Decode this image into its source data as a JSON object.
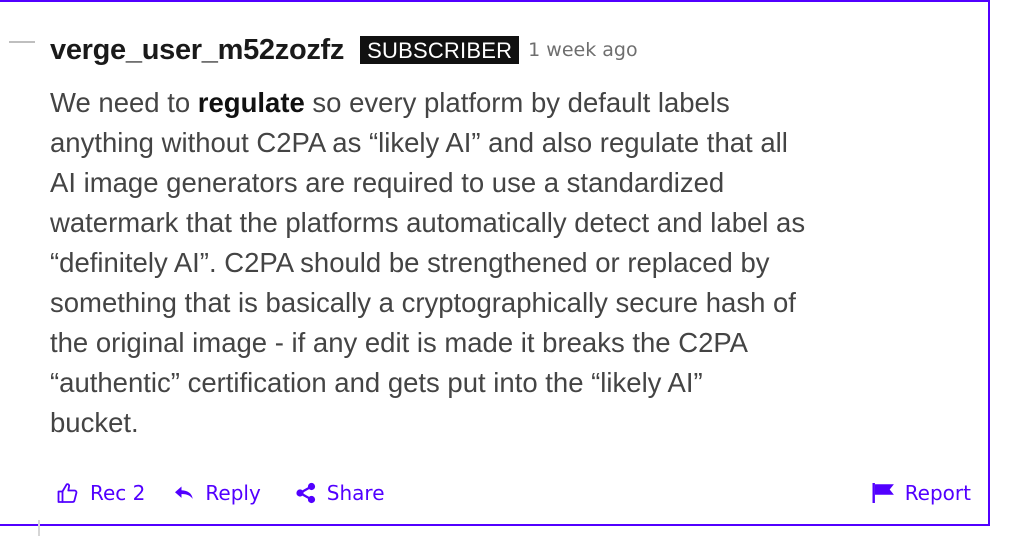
{
  "comment": {
    "username": "verge_user_m52zozfz",
    "badge": "SUBSCRIBER",
    "timestamp": "1 week ago",
    "lines": [
      [
        {
          "text": "We need to "
        },
        {
          "text": "regulate",
          "bold": true
        },
        {
          "text": " so every platform by default labels"
        }
      ],
      [
        {
          "text": "anything without C2PA as “likely AI” and also regulate that all"
        }
      ],
      [
        {
          "text": "AI image generators are required to use a standardized"
        }
      ],
      [
        {
          "text": "watermark that the platforms automatically detect and label as"
        }
      ],
      [
        {
          "text": "“definitely AI”. C2PA should be strengthened or replaced by"
        }
      ],
      [
        {
          "text": "something that is basically a cryptographically secure hash of"
        }
      ],
      [
        {
          "text": "the original image - if any edit is made it breaks the C2PA"
        }
      ],
      [
        {
          "text": "“authentic” certification and gets put into the “likely AI”"
        }
      ],
      [
        {
          "text": "bucket."
        }
      ]
    ]
  },
  "actions": {
    "rec_label": "Rec 2",
    "reply_label": "Reply",
    "share_label": "Share",
    "report_label": "Report"
  },
  "icons": {
    "rec": "thumbs-up-icon",
    "reply": "reply-arrow-icon",
    "share": "share-icon",
    "report": "flag-icon",
    "collapse": "collapse-dash-icon"
  },
  "colors": {
    "accent": "#5200ff",
    "badge_bg": "#111111",
    "badge_text": "#ffffff",
    "body_text": "#444444",
    "username": "#1a1a1a",
    "timestamp": "#6e6e6e"
  }
}
